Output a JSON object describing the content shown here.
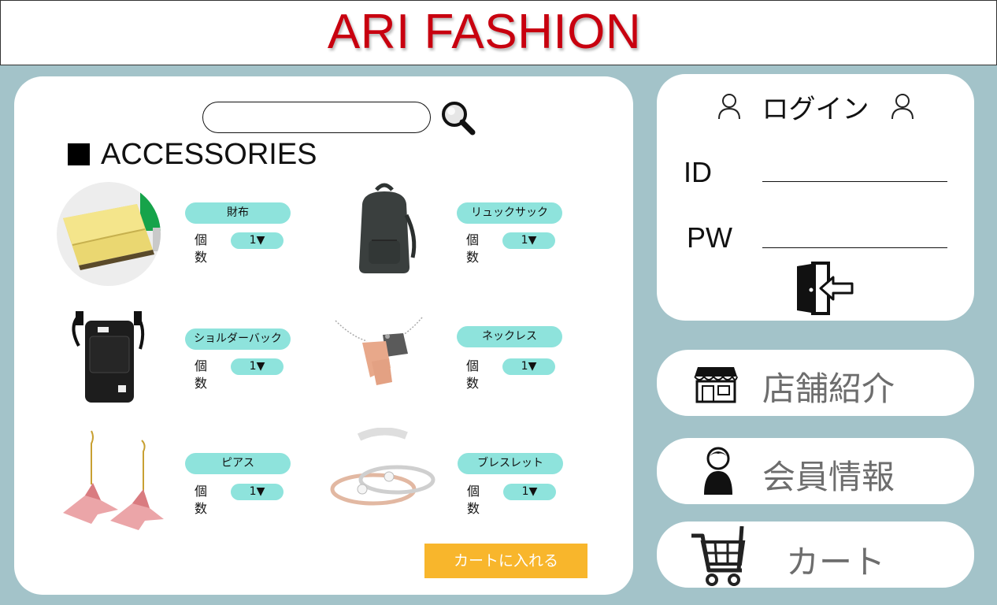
{
  "header": {
    "brand": "ARI FASHION",
    "brand_color": "#c8000f"
  },
  "search": {
    "placeholder": "",
    "icon": "search-icon"
  },
  "section": {
    "title": "ACCESSORIES"
  },
  "products": [
    {
      "name": "財布",
      "image": "yellow-wallet",
      "qty_label": "個数",
      "qty": "1▼"
    },
    {
      "name": "リュックサック",
      "image": "black-backpack",
      "qty_label": "個数",
      "qty": "1▼"
    },
    {
      "name": "ショルダーバック",
      "image": "shoulder-bag",
      "qty_label": "個数",
      "qty": "1▼"
    },
    {
      "name": "ネックレス",
      "image": "puzzle-necklace",
      "qty_label": "個数",
      "qty": "1▼"
    },
    {
      "name": "ピアス",
      "image": "crane-earrings",
      "qty_label": "個数",
      "qty": "1▼"
    },
    {
      "name": "ブレスレット",
      "image": "bangle-bracelets",
      "qty_label": "個数",
      "qty": "1▼"
    }
  ],
  "cart_add": {
    "label": "カートに入れる",
    "color": "#f8b62c"
  },
  "login": {
    "title": "ログイン",
    "id_label": "ID",
    "pw_label": "PW",
    "id_value": "",
    "pw_value": "",
    "login_icon": "door-enter-icon"
  },
  "nav": {
    "shop_info": {
      "label": "店舗紹介",
      "icon": "storefront-icon"
    },
    "member_info": {
      "label": "会員情報",
      "icon": "person-icon"
    },
    "cart": {
      "label": "カート",
      "icon": "cart-icon"
    }
  },
  "colors": {
    "background": "#a3c3c9",
    "pill": "#8ee3dc",
    "nav_text": "#6d6d6d"
  }
}
